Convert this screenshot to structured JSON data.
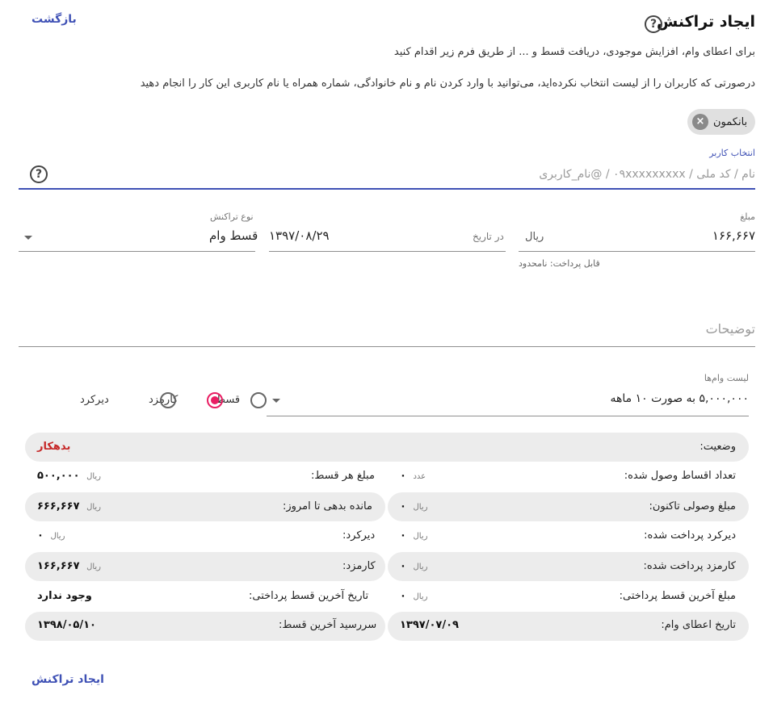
{
  "header": {
    "title": "ایجاد تراکنش",
    "help": "?",
    "back_label": "بازگشت",
    "desc1": "برای اعطای وام، افزایش موجودی، دریافت قسط و ... از طریق فرم زیر اقدام کنید",
    "desc2": "درصورتی که کاربران را از لیست انتخاب نکرده‌اید، می‌توانید با وارد کردن نام و نام خانوادگی، شماره همراه یا نام کاربری این کار را انجام دهید"
  },
  "chip": {
    "label": "بانکمون",
    "remove": "×"
  },
  "user_select": {
    "label": "انتخاب کاربر",
    "placeholder": "نام / کد ملی / ۰۹xxxxxxxxx / @نام_کاربری",
    "help": "?"
  },
  "amount": {
    "label": "مبلغ",
    "value": "۱۶۶,۶۶۷",
    "unit": "ریال",
    "hint": "قابل پرداخت: نامحدود"
  },
  "date": {
    "label": "در تاریخ",
    "value": "۱۳۹۷/۰۸/۲۹"
  },
  "type": {
    "label": "نوع تراکنش",
    "value": "قسط وام"
  },
  "notes": {
    "placeholder": "توضیحات"
  },
  "loans": {
    "label": "لیست وام‌ها",
    "value": "۵,۰۰۰,۰۰۰ به صورت ۱۰ ماهه"
  },
  "radios": [
    {
      "label": "قسط",
      "checked": false
    },
    {
      "label": "کارمزد",
      "checked": true
    },
    {
      "label": "دیرکرد",
      "checked": false
    }
  ],
  "status": {
    "label": "وضعیت:",
    "value": "بدهکار",
    "color": "#c62828"
  },
  "summary": {
    "installments_received_label": "تعداد اقساط وصول شده:",
    "installments_received_value": "۰",
    "installments_received_unit": "عدد",
    "installment_amount_label": "مبلغ هر قسط:",
    "installment_amount_value": "۵۰۰,۰۰۰",
    "installment_amount_unit": "ریال",
    "collected_label": "مبلغ وصولی تاکنون:",
    "collected_value": "۰",
    "collected_unit": "ریال",
    "remaining_label": "مانده بدهی تا امروز:",
    "remaining_value": "۶۶۶,۶۶۷",
    "remaining_unit": "ریال",
    "late_paid_label": "دیرکرد پرداخت شده:",
    "late_paid_value": "۰",
    "late_paid_unit": "ریال",
    "late_label": "دیرکرد:",
    "late_value": "۰",
    "late_unit": "ریال",
    "fee_paid_label": "کارمزد پرداخت شده:",
    "fee_paid_value": "۰",
    "fee_paid_unit": "ریال",
    "fee_label": "کارمزد:",
    "fee_value": "۱۶۶,۶۶۷",
    "fee_unit": "ریال",
    "last_amount_label": "مبلغ آخرین قسط پرداختی:",
    "last_amount_value": "۰",
    "last_amount_unit": "ریال",
    "last_date_label": "تاریخ آخرین قسط پرداختی:",
    "last_date_value": "وجود ندارد",
    "loan_date_label": "تاریخ اعطای وام:",
    "loan_date_value": "۱۳۹۷/۰۷/۰۹",
    "due_date_label": "سررسید آخرین قسط:",
    "due_date_value": "۱۳۹۸/۰۵/۱۰"
  },
  "footer": {
    "create_label": "ایجاد تراکنش"
  }
}
